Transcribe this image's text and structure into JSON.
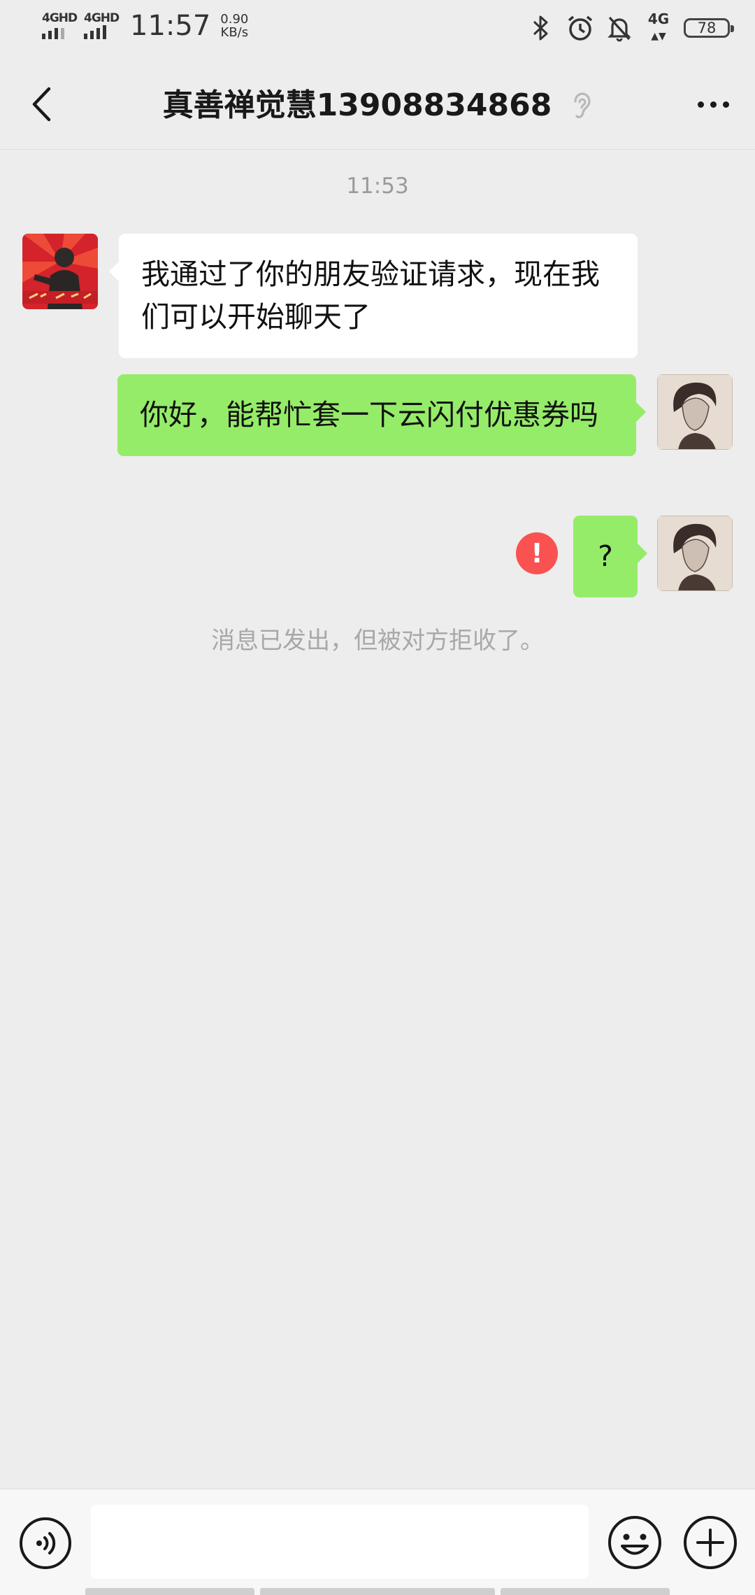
{
  "status_bar": {
    "signal1_label": "4GHD",
    "signal2_label": "4GHD",
    "time": "11:57",
    "speed_value": "0.90",
    "speed_unit": "KB/s",
    "network_label": "4G",
    "battery_level": "78",
    "icons": [
      "bluetooth-icon",
      "alarm-icon",
      "mute-bell-icon"
    ]
  },
  "header": {
    "title": "真善禅觉慧13908834868",
    "back_icon": "chevron-left-icon",
    "ear_icon": "ear-icon",
    "more_icon": "more-dots-icon"
  },
  "chat": {
    "timestamp": "11:53",
    "messages": [
      {
        "direction": "incoming",
        "text": "我通过了你的朋友验证请求，现在我们可以开始聊天了"
      },
      {
        "direction": "outgoing",
        "text": "你好，能帮忙套一下云闪付优惠券吗"
      },
      {
        "direction": "outgoing",
        "text": "?",
        "failed": true,
        "error_icon_text": "!"
      }
    ],
    "system_note": "消息已发出，但被对方拒收了。"
  },
  "input_bar": {
    "voice_icon": "voice-icon",
    "input_value": "",
    "emoji_icon": "emoji-icon",
    "plus_icon": "plus-icon"
  },
  "colors": {
    "background": "#ededed",
    "outgoing_bubble": "#95ec69",
    "incoming_bubble": "#ffffff",
    "error": "#fa5151"
  }
}
